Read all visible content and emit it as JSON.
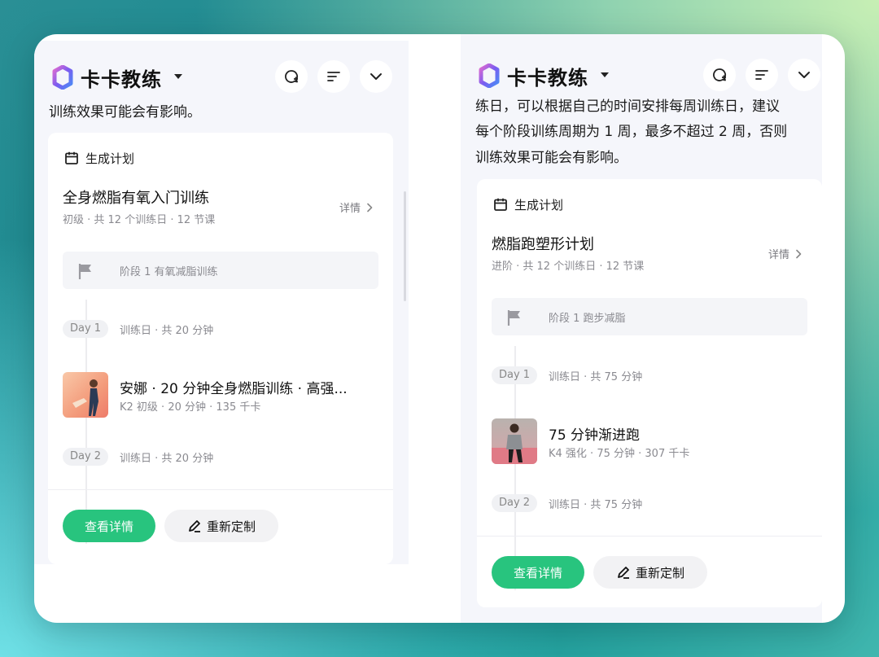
{
  "app": {
    "title": "卡卡教练"
  },
  "left": {
    "intro_lines": [
      "训练效果可能会有影响。"
    ],
    "plan": {
      "header": "生成计划",
      "title": "全身燃脂有氧入门训练",
      "meta": "初级 · 共 12 个训练日 · 12 节课",
      "detail": "详情",
      "stage": "阶段 1 有氧减脂训练",
      "day1": {
        "badge": "Day 1",
        "info": "训练日 · 共 20 分钟"
      },
      "course": {
        "title": "安娜 · 20 分钟全身燃脂训练 · 高强...",
        "meta": "K2 初级 · 20 分钟 · 135 千卡"
      },
      "day2": {
        "badge": "Day 2",
        "info": "训练日 · 共 20 分钟"
      },
      "view_button": "查看详情",
      "customize_button": "重新定制"
    }
  },
  "right": {
    "intro_lines": [
      "练日，可以根据自己的时间安排每周训练日，建议",
      "每个阶段训练周期为 1 周，最多不超过 2 周，否则",
      "训练效果可能会有影响。"
    ],
    "plan": {
      "header": "生成计划",
      "title": "燃脂跑塑形计划",
      "meta": "进阶 · 共 12 个训练日 · 12 节课",
      "detail": "详情",
      "stage": "阶段 1 跑步减脂",
      "day1": {
        "badge": "Day 1",
        "info": "训练日 · 共 75 分钟"
      },
      "course": {
        "title": "75 分钟渐进跑",
        "meta": "K4 强化 · 75 分钟 · 307 千卡"
      },
      "day2": {
        "badge": "Day 2",
        "info": "训练日 · 共 75 分钟"
      },
      "view_button": "查看详情",
      "customize_button": "重新定制"
    }
  },
  "icons": [
    "logo-icon",
    "caret-down-icon",
    "new-chat-icon",
    "menu-icon",
    "chevron-down-icon",
    "calendar-icon",
    "flag-icon",
    "chevron-right-icon",
    "edit-icon"
  ],
  "colors": {
    "primary": "#28c47e",
    "panel": "#f5f6fb",
    "logo_a": "#7b5cf0",
    "logo_b": "#e06bd0"
  }
}
